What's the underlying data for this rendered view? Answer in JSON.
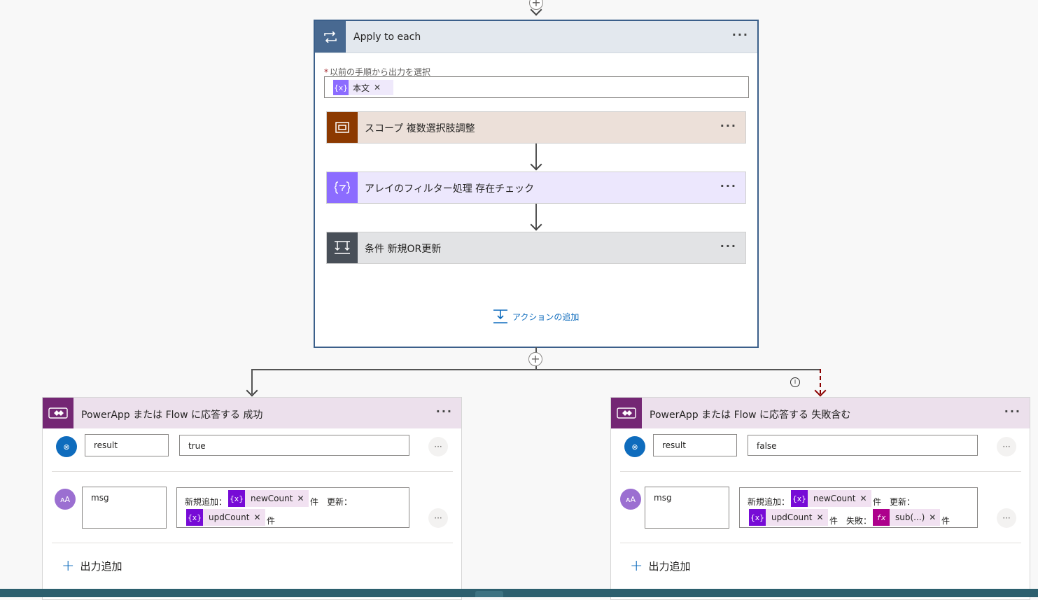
{
  "apply_each": {
    "title": "Apply to each",
    "field_label": "以前の手順から出力を選択",
    "token_label": "本文",
    "add_action_label": "アクションの追加"
  },
  "actions": [
    {
      "title": "スコープ 複数選択肢調整",
      "color": "#8c3900",
      "bg": "#ece0d9"
    },
    {
      "title": "アレイのフィルター処理 存在チェック",
      "color": "#8c6cff",
      "bg": "#ece7fd"
    },
    {
      "title": "条件 新規OR更新",
      "color": "#484f58",
      "bg": "#e2e3e5"
    }
  ],
  "response_success": {
    "title": "PowerApp または Flow に応答する 成功",
    "result_key": "result",
    "result_value": "true",
    "msg_key": "msg",
    "msg_text1": "新規追加：",
    "token_newcount": "newCount",
    "msg_text2": "件　更新：",
    "token_updcount": "updCount",
    "msg_text3": "件",
    "add_output": "出力追加"
  },
  "response_failure": {
    "title": "PowerApp または Flow に応答する 失敗含む",
    "result_key": "result",
    "result_value": "false",
    "msg_key": "msg",
    "msg_text1": "新規追加：",
    "token_newcount": "newCount",
    "msg_text2": "件　更新：",
    "token_updcount": "updCount",
    "msg_text3": "件　失敗：",
    "token_sub": "sub(...)",
    "msg_text4": "件",
    "add_output": "出力追加"
  },
  "colors": {
    "loop": "#486991",
    "powerapps": "#742774",
    "variable_token": "#770bd6",
    "expression_token": "#ad008c",
    "link": "#0f6cbd"
  },
  "icons": [
    "loop-icon",
    "scope-icon",
    "filter-array-icon",
    "condition-icon",
    "powerapps-icon",
    "boolean-icon",
    "text-icon",
    "variable-icon",
    "expression-icon",
    "info-icon",
    "plus-icon",
    "close-icon",
    "more-icon"
  ]
}
